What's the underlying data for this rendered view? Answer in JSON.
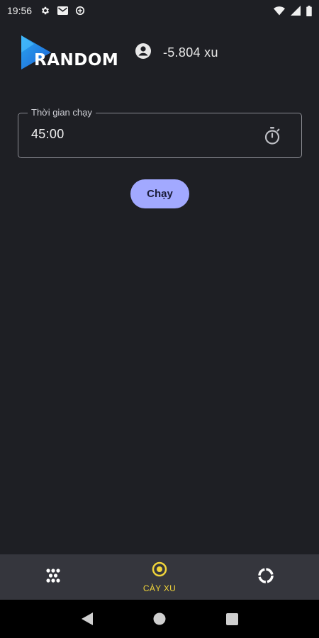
{
  "status_bar": {
    "time": "19:56",
    "icons": [
      "settings-icon",
      "mail-icon",
      "data-saver-icon"
    ],
    "right_icons": [
      "wifi-icon",
      "signal-icon",
      "battery-icon"
    ]
  },
  "header": {
    "logo_text": "RANDOM",
    "logo_colors": [
      "#2aa6f0",
      "#1e63d6"
    ],
    "account_icon": "account-circle-icon",
    "balance": "-5.804 xu"
  },
  "timer_field": {
    "label": "Thời gian chạy",
    "value": "45:00",
    "icon": "stopwatch-icon"
  },
  "run_button": {
    "label": "Chạy",
    "color": "#a2a9ff"
  },
  "bottom_nav": {
    "items": [
      {
        "icon": "dice-icon",
        "label": "",
        "active": false
      },
      {
        "icon": "target-icon",
        "label": "CÀY XU",
        "active": true
      },
      {
        "icon": "refresh-circle-icon",
        "label": "",
        "active": false
      }
    ],
    "active_color": "#f0d43a"
  },
  "system_nav": {
    "buttons": [
      "back-icon",
      "home-icon",
      "recents-icon"
    ]
  }
}
